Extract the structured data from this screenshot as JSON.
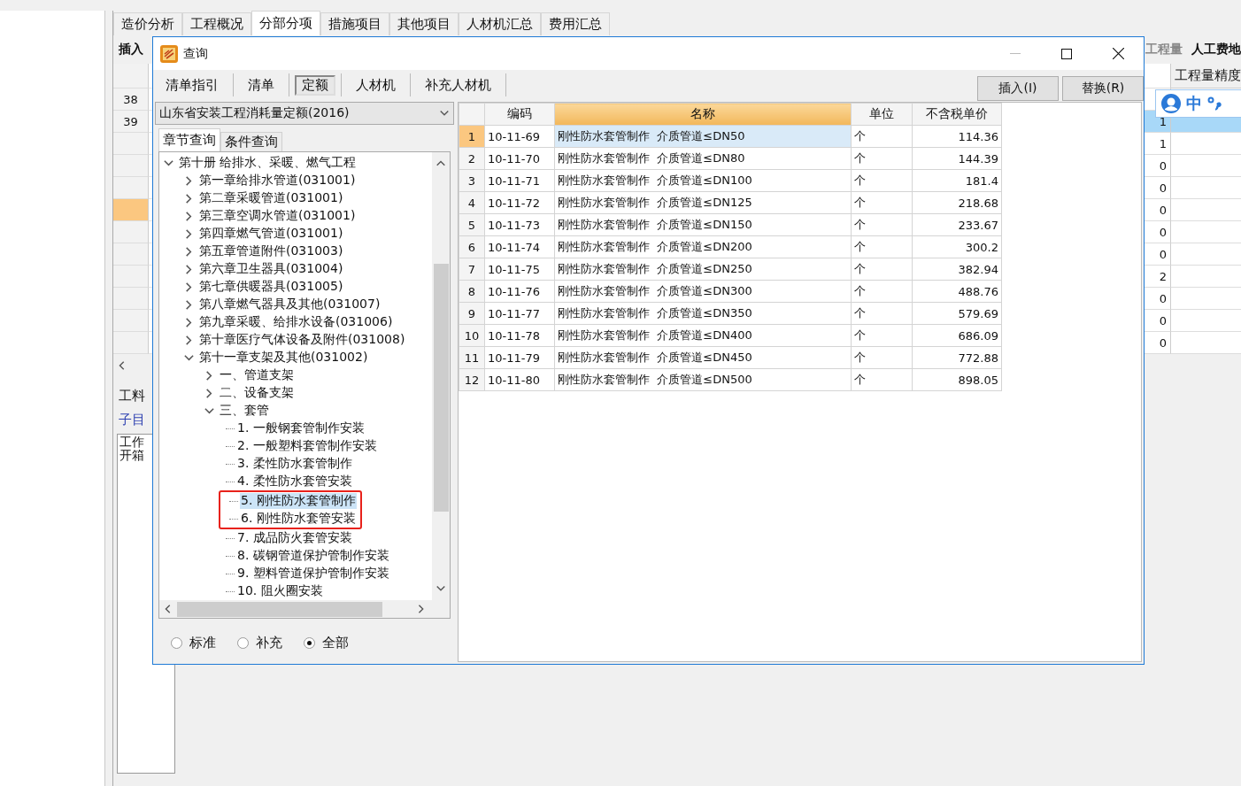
{
  "app": {
    "tabs": [
      {
        "label": "造价分析",
        "selected": false
      },
      {
        "label": "工程概况",
        "selected": false
      },
      {
        "label": "分部分项",
        "selected": true
      },
      {
        "label": "措施项目",
        "selected": false
      },
      {
        "label": "其他项目",
        "selected": false
      },
      {
        "label": "人材机汇总",
        "selected": false
      },
      {
        "label": "费用汇总",
        "selected": false
      }
    ],
    "toolbar": {
      "insert": "插入",
      "quantity": "工程量",
      "labor": "人工费地"
    },
    "grid": {
      "precision_header": "工程量精度",
      "rows": [
        {
          "number": "38",
          "selected": false,
          "current": false
        },
        {
          "number": "39",
          "quantity": "1",
          "selected": true,
          "current": false
        },
        {
          "quantity": "1",
          "selected": false,
          "current": false
        },
        {
          "quantity": "0",
          "selected": false,
          "current": false
        },
        {
          "quantity": "0",
          "selected": false,
          "current": false
        },
        {
          "quantity": "0",
          "selected": false,
          "current": true
        },
        {
          "quantity": "0",
          "selected": false,
          "current": false
        },
        {
          "quantity": "0",
          "selected": false,
          "current": false
        },
        {
          "quantity": "2",
          "selected": false,
          "current": false
        },
        {
          "quantity": "0",
          "selected": false,
          "current": false
        },
        {
          "quantity": "0",
          "selected": false,
          "current": false
        },
        {
          "quantity": "0",
          "selected": false,
          "current": false
        }
      ]
    },
    "bottom_tabs": [
      {
        "label": "工料",
        "kind": "plain"
      },
      {
        "label": "子目",
        "kind": "link"
      }
    ],
    "notes": [
      "工作",
      "开箱"
    ],
    "ime": {
      "mode": "中"
    }
  },
  "dialog": {
    "title": "查询",
    "tabs": [
      {
        "label": "清单指引",
        "selected": false
      },
      {
        "label": "清单",
        "selected": false
      },
      {
        "label": "定额",
        "selected": true
      },
      {
        "label": "人材机",
        "selected": false
      },
      {
        "label": "补充人材机",
        "selected": false
      }
    ],
    "actions": [
      "插入(I)",
      "替换(R)"
    ],
    "library": "山东省安装工程消耗量定额(2016)",
    "search_tabs": [
      {
        "label": "章节查询",
        "selected": true
      },
      {
        "label": "条件查询",
        "selected": false
      }
    ],
    "tree": [
      {
        "label": "第十册  给排水、采暖、燃气工程",
        "expanded": true,
        "selected": false,
        "children": [
          {
            "label": "第一章给排水管道(031001)",
            "expanded": false,
            "selected": false
          },
          {
            "label": "第二章采暖管道(031001)",
            "expanded": false,
            "selected": false
          },
          {
            "label": "第三章空调水管道(031001)",
            "expanded": false,
            "selected": false
          },
          {
            "label": "第四章燃气管道(031001)",
            "expanded": false,
            "selected": false
          },
          {
            "label": "第五章管道附件(031003)",
            "expanded": false,
            "selected": false
          },
          {
            "label": "第六章卫生器具(031004)",
            "expanded": false,
            "selected": false
          },
          {
            "label": "第七章供暖器具(031005)",
            "expanded": false,
            "selected": false
          },
          {
            "label": "第八章燃气器具及其他(031007)",
            "expanded": false,
            "selected": false
          },
          {
            "label": "第九章采暖、给排水设备(031006)",
            "expanded": false,
            "selected": false
          },
          {
            "label": "第十章医疗气体设备及附件(031008)",
            "expanded": false,
            "selected": false
          },
          {
            "label": "第十一章支架及其他(031002)",
            "expanded": true,
            "selected": false,
            "children": [
              {
                "label": "一、管道支架",
                "expanded": false,
                "selected": false
              },
              {
                "label": "二、设备支架",
                "expanded": false,
                "selected": false
              },
              {
                "label": "三、套管",
                "expanded": true,
                "selected": false,
                "children": [
                  {
                    "label": "1. 一般钢套管制作安装",
                    "selected": false,
                    "highlighted": false
                  },
                  {
                    "label": "2. 一般塑料套管制作安装",
                    "selected": false,
                    "highlighted": false
                  },
                  {
                    "label": "3. 柔性防水套管制作",
                    "selected": false,
                    "highlighted": false
                  },
                  {
                    "label": "4. 柔性防水套管安装",
                    "selected": false,
                    "highlighted": false
                  },
                  {
                    "label": "5. 刚性防水套管制作",
                    "selected": true,
                    "highlighted": true
                  },
                  {
                    "label": "6. 刚性防水套管安装",
                    "selected": false,
                    "highlighted": true
                  },
                  {
                    "label": "7. 成品防火套管安装",
                    "selected": false,
                    "highlighted": false
                  },
                  {
                    "label": "8. 碳钢管道保护管制作安装",
                    "selected": false,
                    "highlighted": false
                  },
                  {
                    "label": "9. 塑料管道保护管制作安装",
                    "selected": false,
                    "highlighted": false
                  },
                  {
                    "label": "10. 阻火圈安装",
                    "selected": false,
                    "highlighted": false
                  }
                ]
              }
            ]
          }
        ]
      }
    ],
    "filters": [
      {
        "label": "标准",
        "selected": false
      },
      {
        "label": "补充",
        "selected": false
      },
      {
        "label": "全部",
        "selected": true
      }
    ],
    "table": {
      "columns": [
        {
          "label": "编码",
          "active": false
        },
        {
          "label": "名称",
          "active": true
        },
        {
          "label": "单位",
          "active": false
        },
        {
          "label": "不含税单价",
          "active": false
        }
      ],
      "rows": [
        {
          "index": "1",
          "code": "10-11-69",
          "name": "刚性防水套管制作  介质管道≤DN50",
          "unit": "个",
          "price": "114.36",
          "selected": true
        },
        {
          "index": "2",
          "code": "10-11-70",
          "name": "刚性防水套管制作  介质管道≤DN80",
          "unit": "个",
          "price": "144.39",
          "selected": false
        },
        {
          "index": "3",
          "code": "10-11-71",
          "name": "刚性防水套管制作  介质管道≤DN100",
          "unit": "个",
          "price": "181.4",
          "selected": false
        },
        {
          "index": "4",
          "code": "10-11-72",
          "name": "刚性防水套管制作  介质管道≤DN125",
          "unit": "个",
          "price": "218.68",
          "selected": false
        },
        {
          "index": "5",
          "code": "10-11-73",
          "name": "刚性防水套管制作  介质管道≤DN150",
          "unit": "个",
          "price": "233.67",
          "selected": false
        },
        {
          "index": "6",
          "code": "10-11-74",
          "name": "刚性防水套管制作  介质管道≤DN200",
          "unit": "个",
          "price": "300.2",
          "selected": false
        },
        {
          "index": "7",
          "code": "10-11-75",
          "name": "刚性防水套管制作  介质管道≤DN250",
          "unit": "个",
          "price": "382.94",
          "selected": false
        },
        {
          "index": "8",
          "code": "10-11-76",
          "name": "刚性防水套管制作  介质管道≤DN300",
          "unit": "个",
          "price": "488.76",
          "selected": false
        },
        {
          "index": "9",
          "code": "10-11-77",
          "name": "刚性防水套管制作  介质管道≤DN350",
          "unit": "个",
          "price": "579.69",
          "selected": false
        },
        {
          "index": "10",
          "code": "10-11-78",
          "name": "刚性防水套管制作  介质管道≤DN400",
          "unit": "个",
          "price": "686.09",
          "selected": false
        },
        {
          "index": "11",
          "code": "10-11-79",
          "name": "刚性防水套管制作  介质管道≤DN450",
          "unit": "个",
          "price": "772.88",
          "selected": false
        },
        {
          "index": "12",
          "code": "10-11-80",
          "name": "刚性防水套管制作  介质管道≤DN500",
          "unit": "个",
          "price": "898.05",
          "selected": false
        }
      ]
    }
  }
}
